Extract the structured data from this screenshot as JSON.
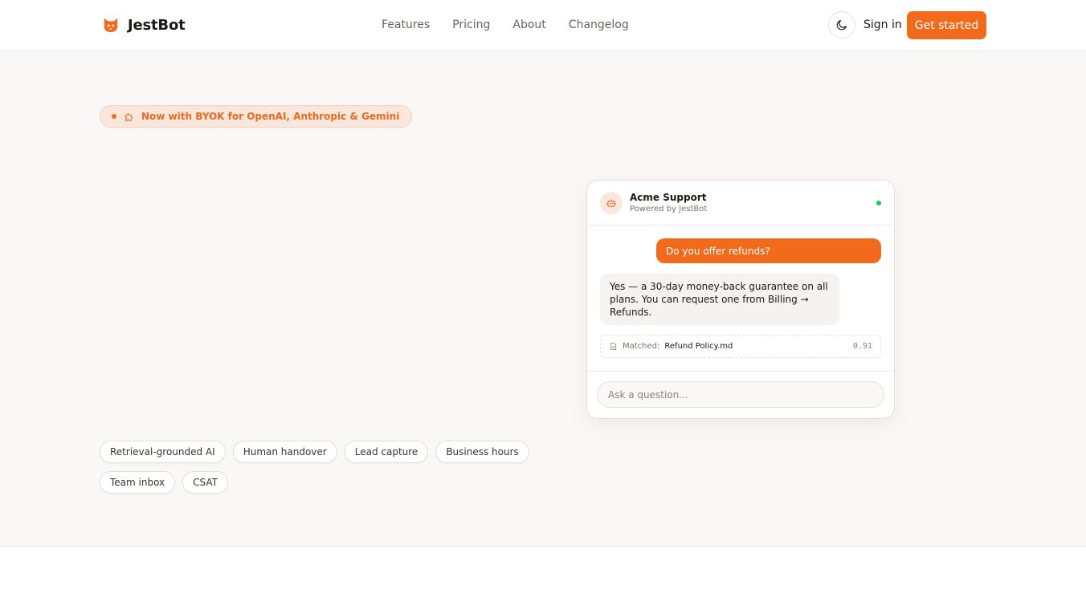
{
  "brand": {
    "name": "JestBot",
    "accent": "#f26b1d",
    "logo_icon": "cat-face-icon"
  },
  "nav": {
    "items": [
      "Features",
      "Pricing",
      "About",
      "Changelog"
    ]
  },
  "header": {
    "theme_icon": "moon-icon",
    "signin_label": "Sign in",
    "cta_label": "Get started"
  },
  "hero": {
    "badge_text": "Now with BYOK for OpenAI, Anthropic & Gemini",
    "badge_icon": "puzzle-icon",
    "chips": [
      "Retrieval-grounded AI",
      "Human handover",
      "Lead capture",
      "Business hours",
      "Team inbox",
      "CSAT"
    ]
  },
  "widget": {
    "title": "Acme Support",
    "subtitle": "Powered by JestBot",
    "avatar_icon": "bot-icon",
    "status_color": "#22c55e",
    "user_message": "Do you offer refunds?",
    "bot_message": "Yes — a 30-day money-back guarantee on all plans. You can request one from Billing → Refunds.",
    "match_icon": "document-icon",
    "match_label": "Matched:",
    "match_file": "Refund Policy.md",
    "match_score": "0.91",
    "input_placeholder": "Ask a question..."
  }
}
